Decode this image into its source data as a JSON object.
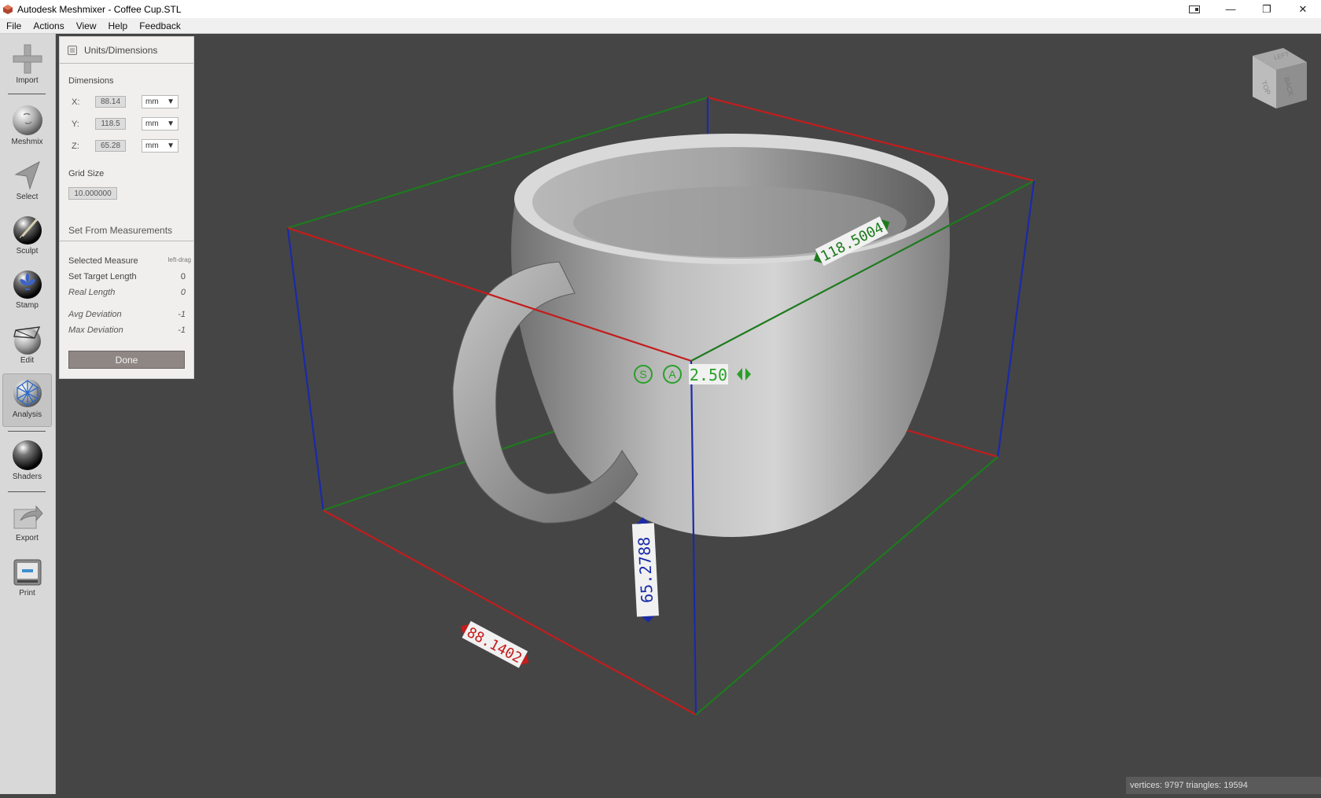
{
  "window": {
    "title": "Autodesk Meshmixer - Coffee Cup.STL",
    "controls": {
      "minimize": "—",
      "maximize": "❐",
      "close": "✕"
    }
  },
  "menu": [
    "File",
    "Actions",
    "View",
    "Help",
    "Feedback"
  ],
  "toolbar": {
    "items": [
      {
        "label": "Import",
        "icon": "plus-icon"
      },
      {
        "label": "Meshmix",
        "icon": "meshmix-sphere-icon"
      },
      {
        "label": "Select",
        "icon": "arrow-cursor-icon"
      },
      {
        "label": "Sculpt",
        "icon": "brush-sphere-icon"
      },
      {
        "label": "Stamp",
        "icon": "stamp-sphere-icon"
      },
      {
        "label": "Edit",
        "icon": "edit-sphere-icon"
      },
      {
        "label": "Analysis",
        "icon": "analysis-sphere-icon",
        "active": true
      },
      {
        "label": "Shaders",
        "icon": "shader-sphere-icon"
      },
      {
        "label": "Export",
        "icon": "export-icon"
      },
      {
        "label": "Print",
        "icon": "printer-icon"
      }
    ]
  },
  "panel": {
    "title": "Units/Dimensions",
    "dimensions_label": "Dimensions",
    "dims": [
      {
        "axis": "X:",
        "value": "88.14",
        "unit": "mm"
      },
      {
        "axis": "Y:",
        "value": "118.5",
        "unit": "mm"
      },
      {
        "axis": "Z:",
        "value": "65.28",
        "unit": "mm"
      }
    ],
    "grid_label": "Grid Size",
    "grid_value": "10.000000",
    "measure_title": "Set From Measurements",
    "selected_measure_label": "Selected Measure",
    "selected_measure_value": "left-drag",
    "target_label": "Set Target Length",
    "target_value": "0",
    "real_label": "Real Length",
    "real_value": "0",
    "avg_label": "Avg Deviation",
    "avg_value": "-1",
    "max_label": "Max Deviation",
    "max_value": "-1",
    "done_label": "Done"
  },
  "viewport": {
    "width_label": "88.1402",
    "depth_label": "118.5004",
    "height_label": "65.2788",
    "gizmo_s": "S",
    "gizmo_a": "A",
    "gizmo_value": "2.50",
    "cube_faces": [
      "TOP",
      "BACK",
      "LEFT"
    ],
    "colors": {
      "x_axis": "#c41c1c",
      "y_axis": "#1d7a1d",
      "z_axis": "#1a2aa8",
      "background": "#454545"
    }
  },
  "status": {
    "text": "vertices: 9797 triangles: 19594"
  }
}
